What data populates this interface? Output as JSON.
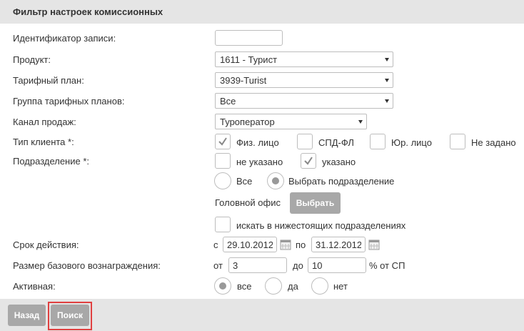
{
  "header": {
    "title": "Фильтр настроек комиссионных"
  },
  "labels": {
    "record_id": "Идентификатор записи:",
    "product": "Продукт:",
    "tariff_plan": "Тарифный план:",
    "tariff_group": "Группа тарифных планов:",
    "sales_channel": "Канал продаж:",
    "client_type": "Тип клиента *:",
    "subdivision": "Подразделение *:",
    "validity": "Срок действия:",
    "base_reward": "Размер базового вознаграждения:",
    "active": "Активная:"
  },
  "fields": {
    "record_id": "",
    "product": "1611 - Турист",
    "tariff_plan": "3939-Turist",
    "tariff_group": "Все",
    "sales_channel": "Туроператор"
  },
  "client_types": [
    {
      "label": "Физ. лицо",
      "checked": true
    },
    {
      "label": "СПД-ФЛ",
      "checked": false
    },
    {
      "label": "Юр. лицо",
      "checked": false
    },
    {
      "label": "Не задано",
      "checked": false
    }
  ],
  "subdivision": {
    "not_specified": {
      "label": "не указано",
      "checked": false
    },
    "specified": {
      "label": "указано",
      "checked": true
    },
    "radio_all": {
      "label": "Все",
      "selected": false
    },
    "radio_choose": {
      "label": "Выбрать подразделение",
      "selected": true
    },
    "office": "Головной офис",
    "choose_button": "Выбрать",
    "search_lower": {
      "label": "искать в нижестоящих подразделениях",
      "checked": false
    }
  },
  "validity": {
    "from_label": "с",
    "from": "29.10.2012",
    "to_label": "по",
    "to": "31.12.2012"
  },
  "base_reward": {
    "from_label": "от",
    "from": "3",
    "to_label": "до",
    "to": "10",
    "unit": "% от СП"
  },
  "active": [
    {
      "label": "все",
      "selected": true
    },
    {
      "label": "да",
      "selected": false
    },
    {
      "label": "нет",
      "selected": false
    }
  ],
  "footer": {
    "back": "Назад",
    "search": "Поиск"
  },
  "colors": {
    "header_bg": "#e5e5e5",
    "button_bg": "#a8a8a8",
    "highlight": "#e04040"
  }
}
